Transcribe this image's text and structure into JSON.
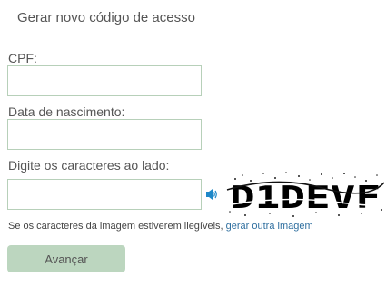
{
  "form": {
    "title": "Gerar novo código de acesso",
    "cpf": {
      "label": "CPF:",
      "value": "",
      "placeholder": ""
    },
    "birthdate": {
      "label": "Data de nascimento:",
      "value": "",
      "placeholder": ""
    },
    "captcha": {
      "label": "Digite os caracteres ao lado:",
      "value": "",
      "placeholder": "",
      "image_text": "D1DEVF",
      "audio_icon": "speaker-icon"
    },
    "hint": {
      "text": "Se os caracteres da imagem estiverem ilegíveis, ",
      "link": "gerar outra imagem"
    },
    "submit_label": "Avançar"
  },
  "colors": {
    "field_border": "#b7d0b9",
    "button_bg": "#bcd6bf",
    "link": "#2f6f9f",
    "audio_icon": "#1e88c8"
  }
}
